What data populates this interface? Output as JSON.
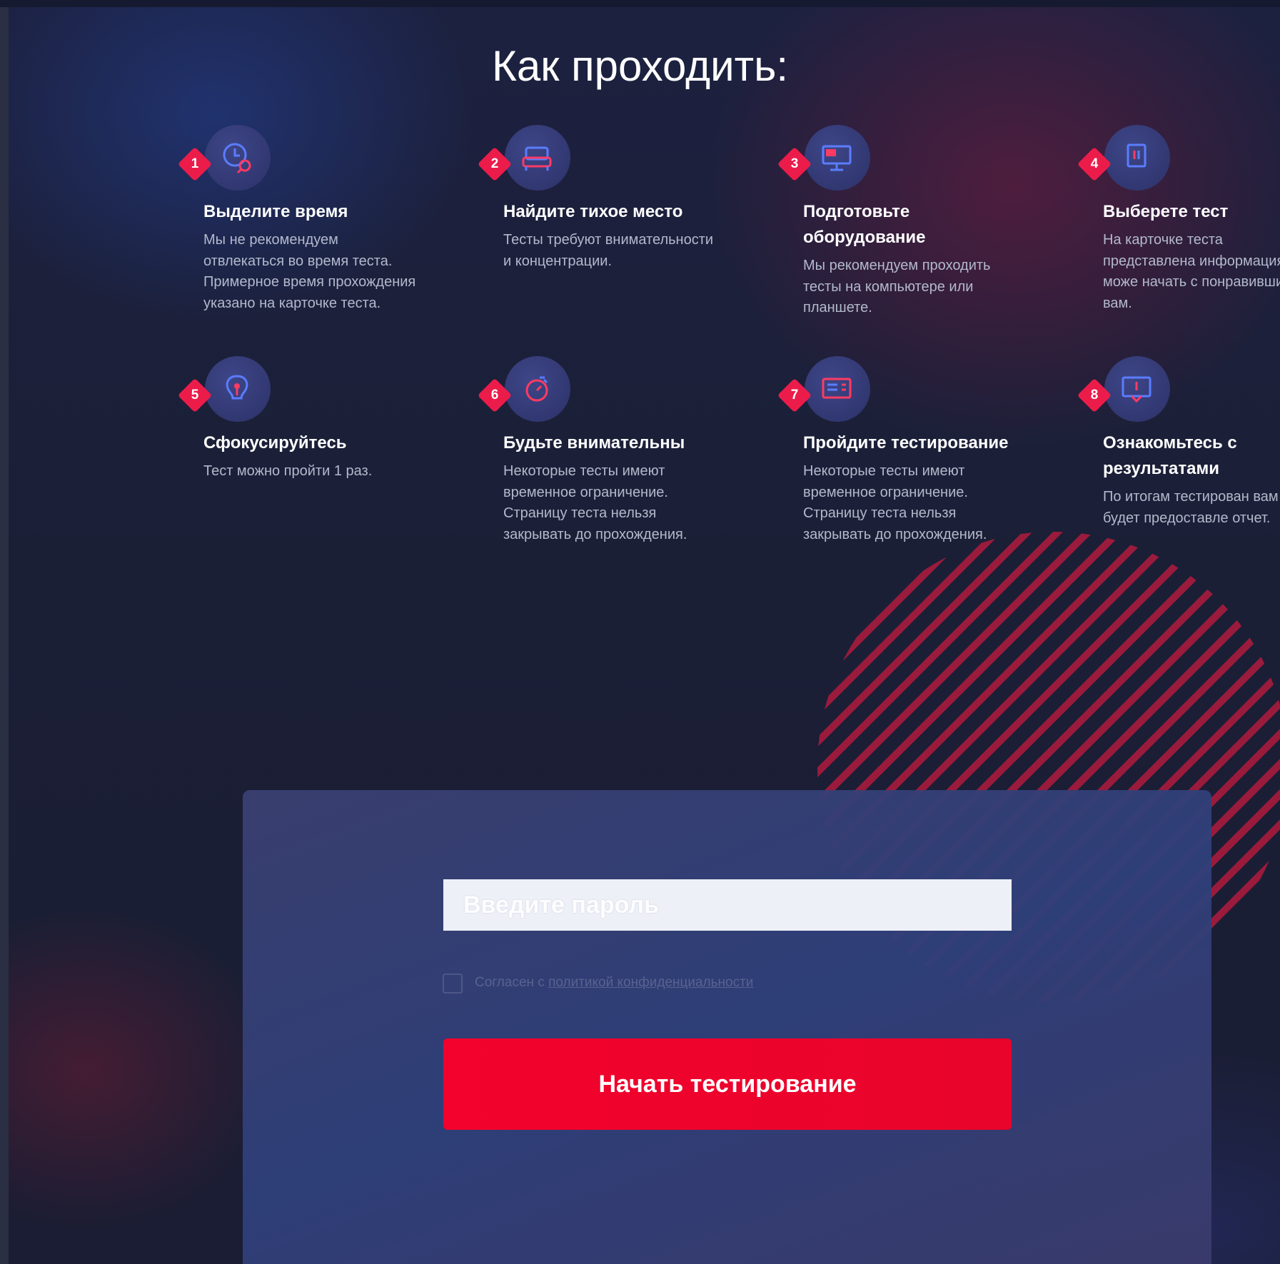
{
  "title": "Как проходить:",
  "steps": [
    {
      "num": "1",
      "icon": "clock-search-icon",
      "title": "Выделите время",
      "text": "Мы не рекомендуем отвлекаться во время теста. Примерное время прохождения указано на карточке теста."
    },
    {
      "num": "2",
      "icon": "armchair-icon",
      "title": "Найдите тихое место",
      "text": "Тесты требуют внимательности и концентрации."
    },
    {
      "num": "3",
      "icon": "computer-icon",
      "title": "Подготовьте оборудование",
      "text": "Мы рекомендуем проходить тесты на компьютере или планшете."
    },
    {
      "num": "4",
      "icon": "document-icon",
      "title": "Выберете тест",
      "text": "На карточке теста представлена информация, вы може начать с понравившихс вам."
    },
    {
      "num": "5",
      "icon": "lightbulb-icon",
      "title": "Сфокусируйтесь",
      "text": "Тест можно пройти 1 раз."
    },
    {
      "num": "6",
      "icon": "stopwatch-icon",
      "title": "Будьте внимательны",
      "text": "Некоторые тесты имеют временное ограничение. Страницу теста нельзя закрывать до прохождения."
    },
    {
      "num": "7",
      "icon": "test-list-icon",
      "title": "Пройдите тестирование",
      "text": "Некоторые тесты имеют временное ограничение. Страницу теста нельзя закрывать до прохождения."
    },
    {
      "num": "8",
      "icon": "results-screen-icon",
      "title": "Ознакомьтесь с результатами",
      "text": "По итогам тестирован вам будет предоставле отчет."
    }
  ],
  "form": {
    "password_placeholder": "Введите пароль",
    "password_value": "",
    "agree_prefix": "Согласен с",
    "agree_link": "политикой конфиденциальности",
    "submit_label": "Начать тестирование"
  },
  "colors": {
    "accent": "#f2022d",
    "badge": "#ec1c4a",
    "background": "#1b1f36",
    "card": "#34407a"
  }
}
